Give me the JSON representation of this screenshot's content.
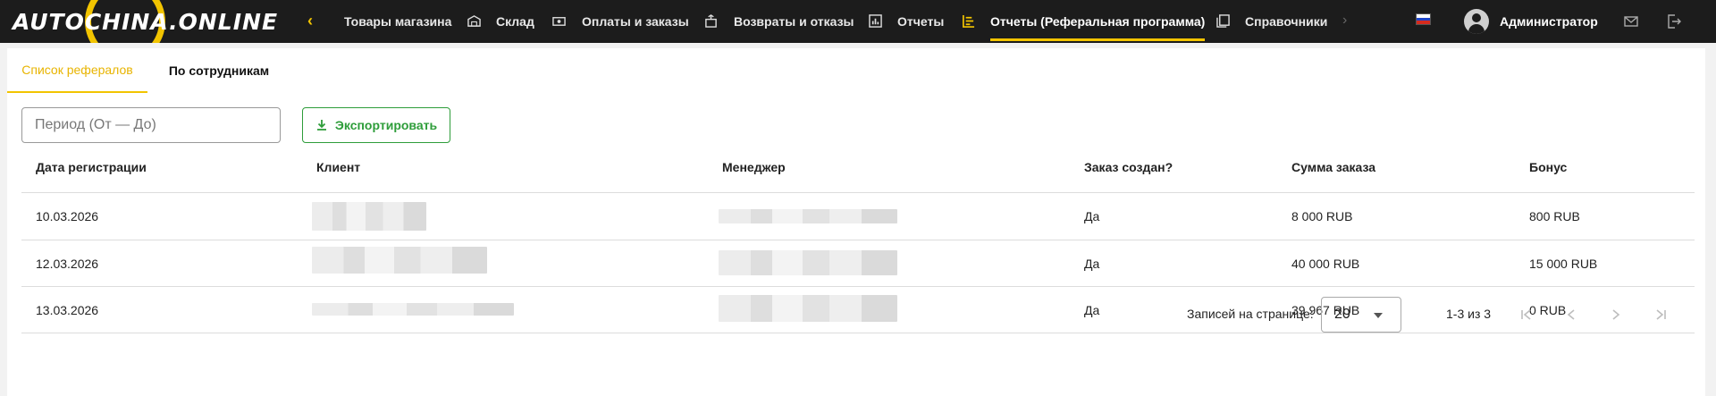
{
  "app": {
    "logo": "AUTOCHINA.ONLINE",
    "brand_color": "#f2c400",
    "accent_green": "#2e9d3a"
  },
  "nav": {
    "items": [
      {
        "label": "Товары магазина",
        "icon": "store-icon",
        "active": false
      },
      {
        "label": "Склад",
        "icon": "warehouse-icon",
        "active": false
      },
      {
        "label": "Оплаты и заказы",
        "icon": "money-icon",
        "active": false
      },
      {
        "label": "Возвраты и отказы",
        "icon": "return-box-icon",
        "active": false
      },
      {
        "label": "Отчеты",
        "icon": "report-chart-icon",
        "active": false
      },
      {
        "label": "Отчеты (Реферальная программа)",
        "icon": "referral-report-icon",
        "active": true
      },
      {
        "label": "Справочники",
        "icon": "books-icon",
        "active": false
      }
    ]
  },
  "user": {
    "name": "Администратор",
    "language": "ru"
  },
  "tabs": [
    {
      "label": "Список рефералов",
      "active": true
    },
    {
      "label": "По сотрудникам",
      "active": false
    }
  ],
  "filters": {
    "period_placeholder": "Период (От — До)",
    "export_label": "Экспортировать"
  },
  "table": {
    "columns": [
      "Дата регистрации",
      "Клиент",
      "Менеджер",
      "Заказ создан?",
      "Сумма заказа",
      "Бонус"
    ],
    "rows": [
      {
        "date": "10.03.2026",
        "order_created": "Да",
        "amount": "8 000 RUB",
        "bonus": "800 RUB"
      },
      {
        "date": "12.03.2026",
        "order_created": "Да",
        "amount": "40 000 RUB",
        "bonus": "15 000 RUB"
      },
      {
        "date": "13.03.2026",
        "order_created": "Да",
        "amount": "39 967 RUB",
        "bonus": "0 RUB"
      }
    ]
  },
  "pagination": {
    "per_page_label": "Записей на странице:",
    "per_page": "20",
    "range": "1-3 из 3"
  }
}
